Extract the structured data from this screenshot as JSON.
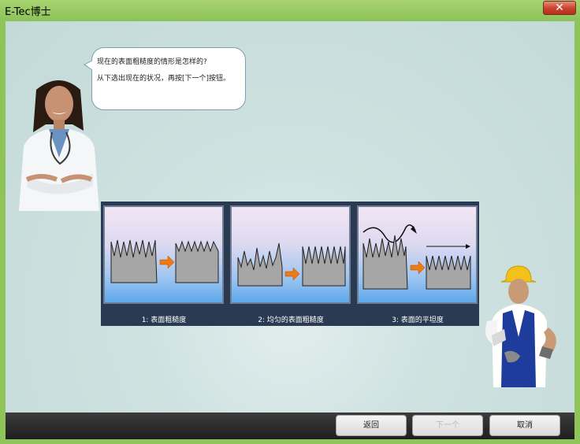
{
  "window": {
    "title": "E-Tec博士",
    "close_label": "✕"
  },
  "speech": {
    "question": "现在的表面粗糙度的情形是怎样的?",
    "instruction": "从下选出现在的状况，再按[下一个]按钮。"
  },
  "options": [
    {
      "label": "1: 表面粗糙度"
    },
    {
      "label": "2: 均匀的表面粗糙度"
    },
    {
      "label": "3: 表面的平坦度"
    }
  ],
  "buttons": {
    "back": "返回",
    "next": "下一个",
    "cancel": "取消"
  },
  "colors": {
    "frame": "#8fc45a",
    "arrow": "#f07a10",
    "surface": "#a6a6a6"
  }
}
